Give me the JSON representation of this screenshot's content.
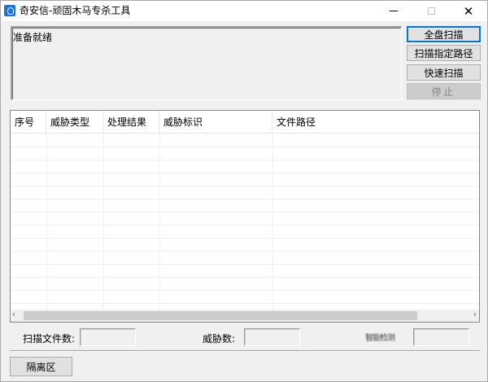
{
  "window": {
    "title": "奇安信-顽固木马专杀工具",
    "icon": "shield-icon",
    "controls": {
      "minimize": "—",
      "maximize": "□",
      "close": "✕"
    }
  },
  "status": {
    "text": "准备就绪"
  },
  "actions": {
    "full_scan": "全盘扫描",
    "scan_path": "扫描指定路径",
    "quick_scan": "快速扫描",
    "stop": "停止"
  },
  "table": {
    "columns": [
      "序号",
      "威胁类型",
      "处理结果",
      "威胁标识",
      "文件路径"
    ],
    "rows": []
  },
  "scrollbar": {
    "left_arrow": "‹",
    "right_arrow": "›"
  },
  "stats": {
    "scanned_files_label": "扫描文件数:",
    "scanned_files_value": "",
    "threats_label": "威胁数:",
    "threats_value": "",
    "third_label": "智能检测",
    "third_value": ""
  },
  "bottom": {
    "quarantine": "隔离区"
  }
}
